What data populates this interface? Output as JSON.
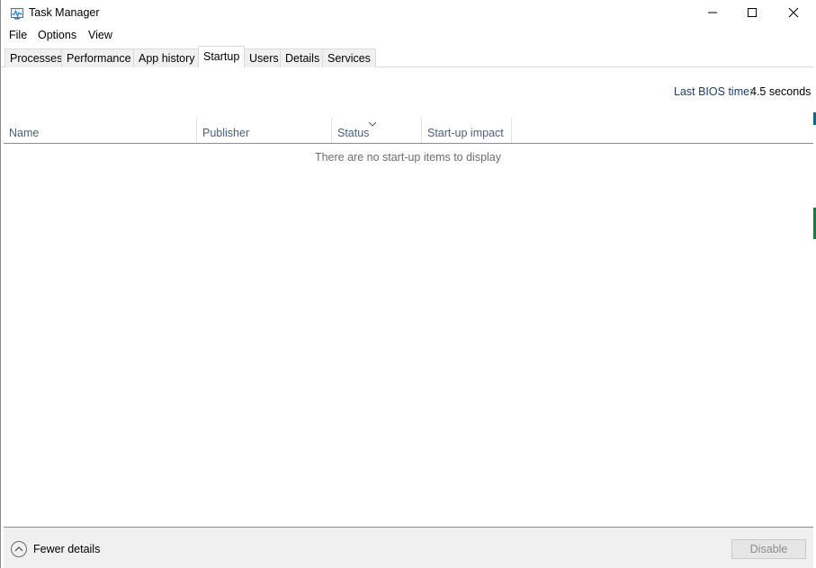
{
  "window": {
    "title": "Task Manager",
    "icon": "task-manager-icon",
    "caption_buttons": [
      "minimize-icon",
      "maximize-icon",
      "close-icon"
    ]
  },
  "menu": {
    "items": [
      "File",
      "Options",
      "View"
    ]
  },
  "tabs": {
    "items": [
      "Processes",
      "Performance",
      "App history",
      "Startup",
      "Users",
      "Details",
      "Services"
    ],
    "active": "Startup"
  },
  "startup": {
    "bios_label": "Last BIOS time:",
    "bios_value": "4.5 seconds",
    "columns": [
      "Name",
      "Publisher",
      "Status",
      "Start-up impact"
    ],
    "sorted_column": "Status",
    "empty_message": "There are no start-up items to display"
  },
  "footer": {
    "fewer_details": "Fewer details",
    "disable_button": "Disable",
    "disable_enabled": false
  },
  "colors": {
    "header_text": "#4c607a",
    "bios_label": "#1e3d6b",
    "desktop_accent_green": "#1b7a3a",
    "desktop_accent_teal": "#0e6a8a"
  }
}
